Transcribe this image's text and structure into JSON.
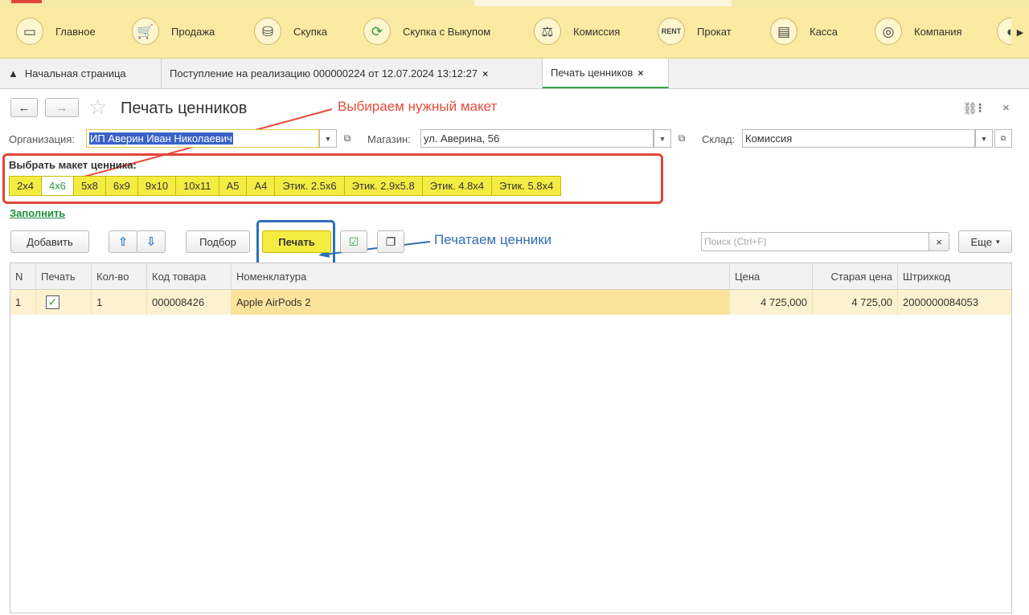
{
  "sections": [
    {
      "label": "Главное",
      "icon": "monitor-icon"
    },
    {
      "label": "Продажа",
      "icon": "cart-icon"
    },
    {
      "label": "Скупка",
      "icon": "bag-icon"
    },
    {
      "label": "Скупка с Выкупом",
      "icon": "cycle-icon"
    },
    {
      "label": "Комиссия",
      "icon": "scales-icon"
    },
    {
      "label": "Прокат",
      "icon": "rent-icon"
    },
    {
      "label": "Касса",
      "icon": "cash-register-icon"
    },
    {
      "label": "Компания",
      "icon": "company-icon"
    }
  ],
  "tabs": {
    "home": "Начальная страница",
    "receipt": "Поступление на реализацию 000000224 от 12.07.2024 13:12:27",
    "print_labels": "Печать ценников",
    "close_glyph": "×"
  },
  "form": {
    "title": "Печать ценников",
    "org_label": "Организация:",
    "org_value": "ИП Аверин Иван Николаевич",
    "store_label": "Магазин:",
    "store_value": "ул. Аверина, 56",
    "warehouse_label": "Склад:",
    "warehouse_value": "Комиссия"
  },
  "annotations": {
    "choose_layout": "Выбираем нужный макет",
    "print_labels": "Печатаем ценники"
  },
  "layout": {
    "title": "Выбрать макет ценника:",
    "options": [
      "2x4",
      "4x6",
      "5x8",
      "6x9",
      "9x10",
      "10x11",
      "A5",
      "A4",
      "Этик. 2.5x6",
      "Этик. 2.9x5.8",
      "Этик. 4.8x4",
      "Этик. 5.8x4"
    ],
    "selected": "4x6"
  },
  "fill_link": "Заполнить",
  "toolbar": {
    "add": "Добавить",
    "pick": "Подбор",
    "print": "Печать",
    "search_placeholder": "Поиск (Ctrl+F)",
    "search_clear": "×",
    "more": "Еще"
  },
  "table": {
    "columns": [
      "N",
      "Печать",
      "Кол-во",
      "Код товара",
      "Номенклатура",
      "Цена",
      "Старая цена",
      "Штрихкод"
    ],
    "rows": [
      {
        "n": "1",
        "print": true,
        "qty": "1",
        "code": "000008426",
        "name": "Apple AirPods 2",
        "price": "4 725,000",
        "old_price": "4 725,00",
        "barcode": "2000000084053"
      }
    ]
  }
}
